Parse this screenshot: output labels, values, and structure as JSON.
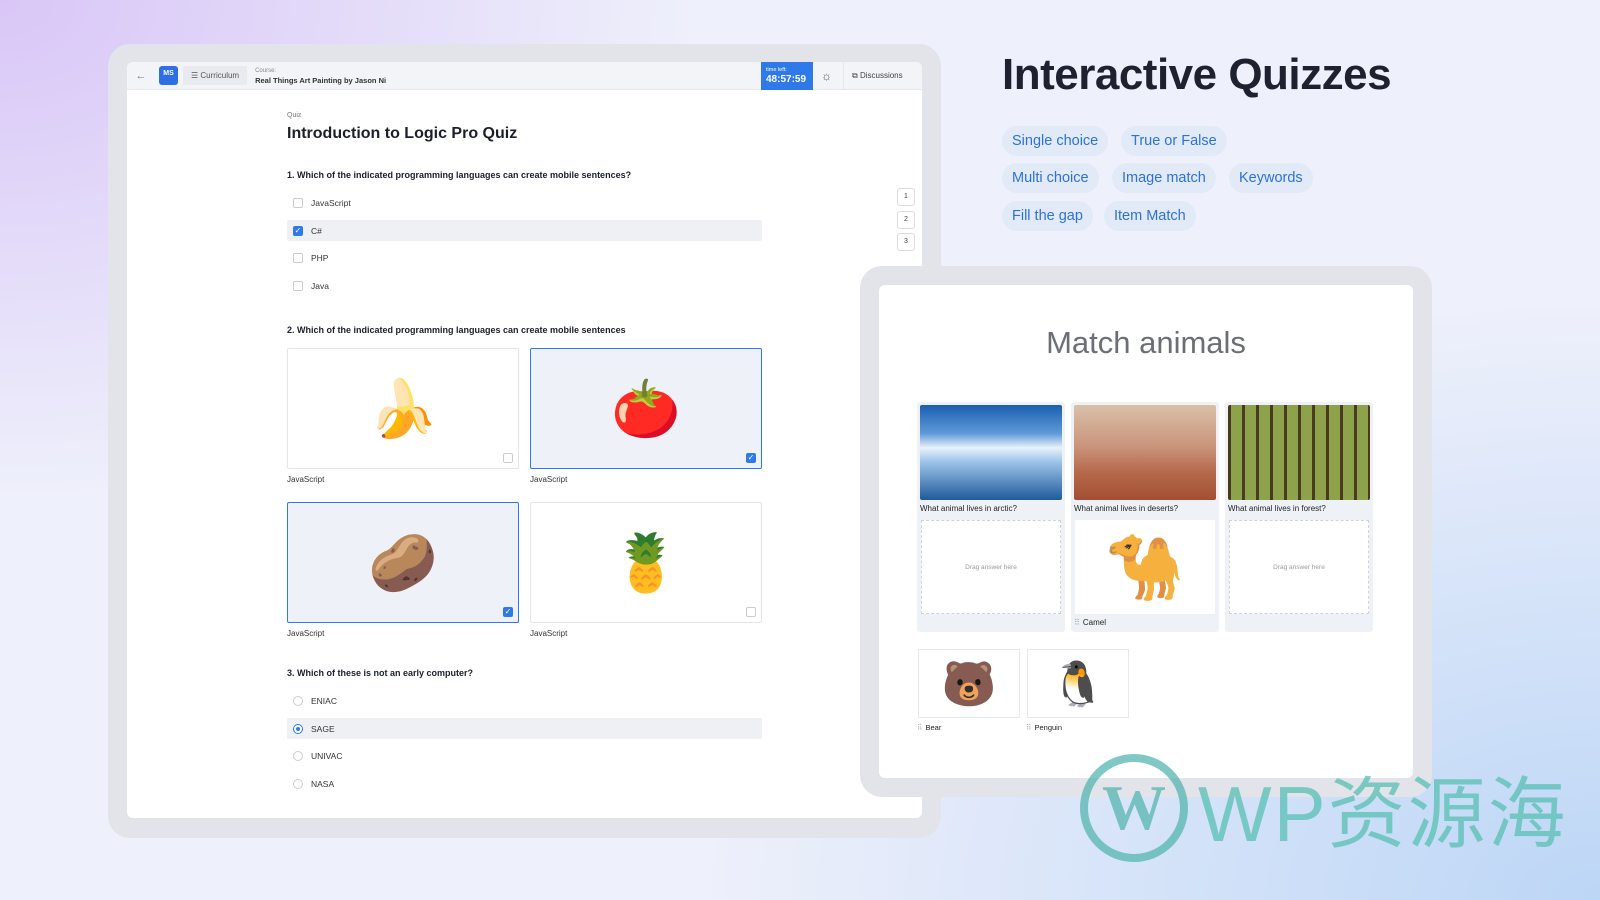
{
  "app": {
    "back_icon": "arrow-left-icon",
    "logo": "MS",
    "curriculum": "Curriculum",
    "course_label": "Course:",
    "course_name": "Real Things Art Painting by Jason Ni",
    "timer_label": "time left:",
    "timer_value": "48:57:59",
    "theme_icon": "sun-icon",
    "discussions": "Discussions",
    "accent": "#2f7ae8"
  },
  "quiz": {
    "label": "Quiz",
    "title": "Introduction to Logic Pro Quiz",
    "q1": {
      "text": "1. Which of the indicated programming languages can create mobile sentences?",
      "options": [
        {
          "label": "JavaScript",
          "checked": false
        },
        {
          "label": "C#",
          "checked": true
        },
        {
          "label": "PHP",
          "checked": false
        },
        {
          "label": "Java",
          "checked": false
        }
      ]
    },
    "q2": {
      "text": "2. Which of the indicated programming languages can create mobile sentences",
      "options": [
        {
          "label": "JavaScript",
          "image": "banana",
          "checked": false
        },
        {
          "label": "JavaScript",
          "image": "tomato",
          "checked": true
        },
        {
          "label": "JavaScript",
          "image": "potato",
          "checked": true
        },
        {
          "label": "JavaScript",
          "image": "pineapple",
          "checked": false
        }
      ]
    },
    "q3": {
      "text": "3. Which of these is not an early computer?",
      "options": [
        {
          "label": "ENIAC",
          "selected": false
        },
        {
          "label": "SAGE",
          "selected": true
        },
        {
          "label": "UNIVAC",
          "selected": false
        },
        {
          "label": "NASA",
          "selected": false
        }
      ]
    },
    "nav": [
      "1",
      "2",
      "3"
    ]
  },
  "promo": {
    "title": "Interactive Quizzes",
    "chips": [
      "Single choice",
      "True or False",
      "Multi choice",
      "Image match",
      "Keywords",
      "Fill the gap",
      "Item Match"
    ]
  },
  "match": {
    "title": "Match animals",
    "drop_placeholder": "Drag answer here",
    "questions": [
      "What animal lives in arctic?",
      "What animal lives in deserts?",
      "What animal lives in forest?"
    ],
    "placed": "Camel",
    "answers": [
      "Bear",
      "Penguin"
    ]
  },
  "watermark": "WP资源海"
}
